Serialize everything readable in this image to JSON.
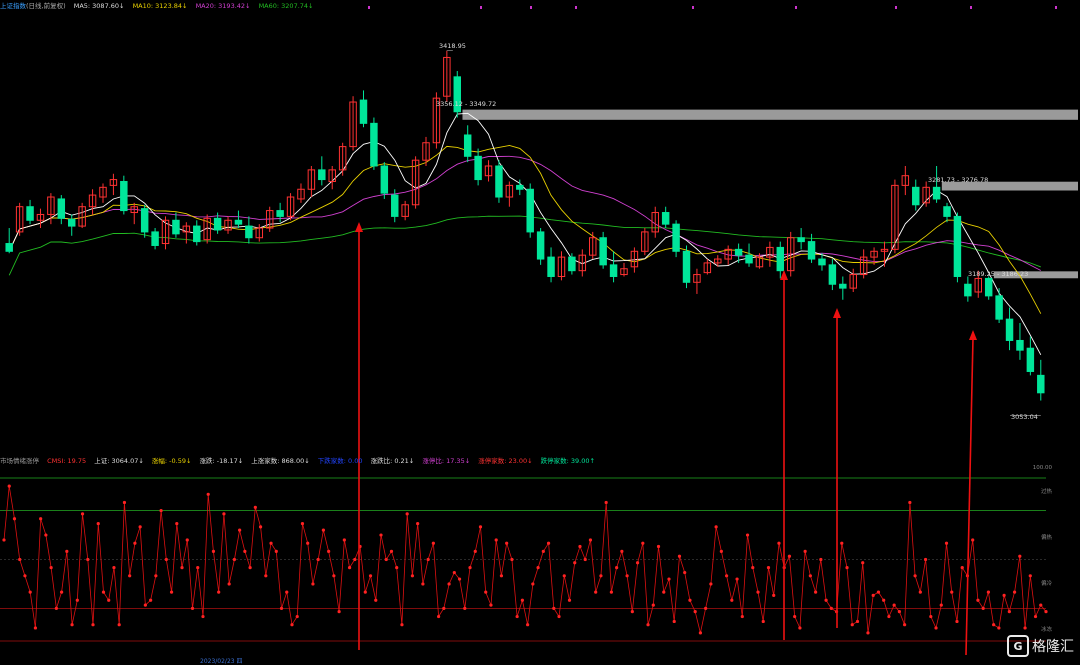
{
  "main_legend": {
    "title": "上证指数",
    "title_suffix": "(日线,前复权)",
    "ma5": "MA5: 3087.60↓",
    "ma10": "MA10: 3123.84↓",
    "ma20": "MA20: 3193.42↓",
    "ma60": "MA60: 3207.74↓"
  },
  "price_labels": {
    "high": "3418.95",
    "zone1": "3356.12 - 3349.72",
    "zone2": "3281.73 - 3276.78",
    "zone3": "3189.25 - 3186.23",
    "low": "3053.04"
  },
  "sub_legend": {
    "title": "市场情绪涨停",
    "cmsi": "CMSI: 19.75",
    "shanghai": "上证: 3064.07↓",
    "change": "涨幅: -0.59↓",
    "change_pts": "涨跌: -18.17↓",
    "up_count": "上涨家数: 868.00↓",
    "blue_item": "下跌家数: 0.00",
    "ratio": "涨跌比: 0.21↓",
    "limit_ratio": "涨停比: 17.35↓",
    "limit_up": "涨停家数: 23.00↓",
    "limit_down": "跌停家数: 39.00↑"
  },
  "sub_axis": {
    "top": "100.00",
    "overheat": "过热",
    "warm": "偏热",
    "cold": "偏冷",
    "freeze": "冰冻"
  },
  "date_label": "2023/02/23 四",
  "watermark": {
    "logo": "G",
    "text": "格隆汇"
  },
  "colors": {
    "up": "#ff3232",
    "down": "#00e69a",
    "ma5": "#ffffff",
    "ma10": "#e8d000",
    "ma20": "#d040d0",
    "ma60": "#22bb22",
    "arrow": "#ee1111"
  },
  "chart_data": [
    {
      "type": "candlestick",
      "title": "上证指数",
      "series_ma": [
        "MA5",
        "MA10",
        "MA20",
        "MA60"
      ],
      "price_range": [
        3040,
        3430
      ],
      "high_marker": 3418.95,
      "low_marker": 3053.04,
      "zones": [
        [
          3349.72,
          3356.12
        ],
        [
          3276.78,
          3281.73
        ],
        [
          3186.23,
          3189.25
        ]
      ],
      "ohlc": [
        [
          3220,
          3236,
          3210,
          3212
        ],
        [
          3232,
          3262,
          3228,
          3258
        ],
        [
          3258,
          3265,
          3240,
          3244
        ],
        [
          3244,
          3256,
          3236,
          3250
        ],
        [
          3250,
          3272,
          3240,
          3268
        ],
        [
          3266,
          3270,
          3240,
          3246
        ],
        [
          3245,
          3250,
          3228,
          3238
        ],
        [
          3238,
          3262,
          3236,
          3258
        ],
        [
          3258,
          3276,
          3250,
          3270
        ],
        [
          3268,
          3282,
          3262,
          3278
        ],
        [
          3280,
          3292,
          3270,
          3286
        ],
        [
          3284,
          3290,
          3250,
          3254
        ],
        [
          3252,
          3262,
          3240,
          3258
        ],
        [
          3256,
          3260,
          3226,
          3232
        ],
        [
          3232,
          3236,
          3214,
          3218
        ],
        [
          3220,
          3248,
          3214,
          3244
        ],
        [
          3244,
          3252,
          3226,
          3230
        ],
        [
          3232,
          3242,
          3220,
          3238
        ],
        [
          3238,
          3244,
          3218,
          3222
        ],
        [
          3224,
          3250,
          3220,
          3246
        ],
        [
          3246,
          3252,
          3230,
          3234
        ],
        [
          3234,
          3248,
          3230,
          3244
        ],
        [
          3244,
          3254,
          3236,
          3240
        ],
        [
          3238,
          3248,
          3220,
          3226
        ],
        [
          3226,
          3240,
          3222,
          3236
        ],
        [
          3236,
          3258,
          3232,
          3254
        ],
        [
          3254,
          3262,
          3242,
          3248
        ],
        [
          3248,
          3272,
          3244,
          3268
        ],
        [
          3266,
          3282,
          3262,
          3276
        ],
        [
          3276,
          3300,
          3268,
          3296
        ],
        [
          3296,
          3310,
          3280,
          3286
        ],
        [
          3284,
          3300,
          3276,
          3296
        ],
        [
          3296,
          3324,
          3290,
          3320
        ],
        [
          3320,
          3372,
          3316,
          3366
        ],
        [
          3368,
          3378,
          3340,
          3344
        ],
        [
          3344,
          3350,
          3296,
          3300
        ],
        [
          3300,
          3304,
          3266,
          3272
        ],
        [
          3270,
          3276,
          3242,
          3248
        ],
        [
          3248,
          3264,
          3244,
          3260
        ],
        [
          3260,
          3310,
          3256,
          3306
        ],
        [
          3306,
          3330,
          3300,
          3324
        ],
        [
          3324,
          3376,
          3318,
          3370
        ],
        [
          3372,
          3419,
          3366,
          3412
        ],
        [
          3392,
          3398,
          3350,
          3356
        ],
        [
          3332,
          3342,
          3304,
          3310
        ],
        [
          3310,
          3318,
          3280,
          3286
        ],
        [
          3290,
          3306,
          3284,
          3300
        ],
        [
          3300,
          3306,
          3262,
          3268
        ],
        [
          3268,
          3284,
          3258,
          3280
        ],
        [
          3280,
          3286,
          3270,
          3276
        ],
        [
          3276,
          3282,
          3226,
          3232
        ],
        [
          3232,
          3236,
          3198,
          3204
        ],
        [
          3206,
          3216,
          3180,
          3186
        ],
        [
          3186,
          3212,
          3182,
          3206
        ],
        [
          3206,
          3210,
          3188,
          3192
        ],
        [
          3192,
          3214,
          3186,
          3208
        ],
        [
          3208,
          3232,
          3204,
          3226
        ],
        [
          3226,
          3232,
          3194,
          3198
        ],
        [
          3198,
          3212,
          3180,
          3186
        ],
        [
          3188,
          3200,
          3186,
          3194
        ],
        [
          3196,
          3216,
          3190,
          3212
        ],
        [
          3212,
          3236,
          3208,
          3232
        ],
        [
          3232,
          3258,
          3226,
          3252
        ],
        [
          3252,
          3258,
          3236,
          3240
        ],
        [
          3240,
          3244,
          3206,
          3212
        ],
        [
          3212,
          3218,
          3174,
          3180
        ],
        [
          3180,
          3194,
          3168,
          3188
        ],
        [
          3190,
          3204,
          3188,
          3200
        ],
        [
          3200,
          3208,
          3196,
          3204
        ],
        [
          3204,
          3218,
          3198,
          3214
        ],
        [
          3214,
          3220,
          3200,
          3208
        ],
        [
          3208,
          3220,
          3196,
          3200
        ],
        [
          3196,
          3210,
          3194,
          3206
        ],
        [
          3206,
          3222,
          3196,
          3216
        ],
        [
          3216,
          3222,
          3184,
          3192
        ],
        [
          3192,
          3232,
          3186,
          3226
        ],
        [
          3226,
          3236,
          3214,
          3222
        ],
        [
          3222,
          3230,
          3200,
          3204
        ],
        [
          3204,
          3210,
          3192,
          3198
        ],
        [
          3198,
          3204,
          3172,
          3178
        ],
        [
          3178,
          3186,
          3162,
          3174
        ],
        [
          3174,
          3194,
          3170,
          3188
        ],
        [
          3188,
          3214,
          3184,
          3206
        ],
        [
          3206,
          3216,
          3198,
          3212
        ],
        [
          3212,
          3222,
          3196,
          3214
        ],
        [
          3214,
          3286,
          3210,
          3280
        ],
        [
          3280,
          3300,
          3270,
          3290
        ],
        [
          3278,
          3286,
          3254,
          3260
        ],
        [
          3262,
          3284,
          3258,
          3278
        ],
        [
          3278,
          3300,
          3262,
          3266
        ],
        [
          3258,
          3262,
          3242,
          3248
        ],
        [
          3248,
          3252,
          3180,
          3186
        ],
        [
          3178,
          3186,
          3160,
          3166
        ],
        [
          3170,
          3192,
          3164,
          3184
        ],
        [
          3184,
          3186,
          3162,
          3166
        ],
        [
          3166,
          3174,
          3138,
          3142
        ],
        [
          3142,
          3154,
          3110,
          3120
        ],
        [
          3120,
          3138,
          3100,
          3110
        ],
        [
          3112,
          3124,
          3084,
          3088
        ],
        [
          3084,
          3100,
          3058,
          3066
        ]
      ]
    },
    {
      "type": "line",
      "title": "市场情绪涨停",
      "ylim": [
        0,
        100
      ],
      "levels": [
        100,
        80,
        20,
        0
      ],
      "values": [
        62,
        95,
        75,
        50,
        40,
        30,
        8,
        75,
        65,
        45,
        20,
        30,
        55,
        10,
        25,
        78,
        50,
        10,
        72,
        30,
        25,
        45,
        10,
        85,
        40,
        60,
        70,
        22,
        25,
        40,
        80,
        50,
        30,
        72,
        45,
        62,
        20,
        45,
        15,
        90,
        55,
        30,
        78,
        35,
        50,
        68,
        55,
        45,
        82,
        70,
        40,
        60,
        55,
        20,
        30,
        10,
        15,
        72,
        60,
        35,
        50,
        68,
        55,
        40,
        18,
        62,
        45,
        50,
        58,
        30,
        40,
        25,
        65,
        50,
        55,
        45,
        10,
        78,
        40,
        72,
        35,
        50,
        60,
        15,
        20,
        35,
        42,
        38,
        20,
        45,
        55,
        70,
        30,
        22,
        62,
        40,
        60,
        50,
        15,
        25,
        10,
        35,
        45,
        55,
        60,
        20,
        15,
        40,
        25,
        48,
        58,
        50,
        62,
        30,
        40,
        85,
        30,
        45,
        55,
        40,
        18,
        48,
        60,
        10,
        22,
        58,
        30,
        38,
        12,
        52,
        42,
        25,
        18,
        5,
        20,
        35,
        70,
        55,
        40,
        25,
        38,
        15,
        65,
        45,
        30,
        12,
        45,
        28,
        60,
        45,
        52,
        15,
        8,
        55,
        40,
        30,
        50,
        25,
        20,
        18,
        60,
        45,
        10,
        12,
        48,
        5,
        28,
        30,
        25,
        15,
        22,
        18,
        10,
        85,
        40,
        30,
        50,
        15,
        8,
        22,
        60,
        30,
        12,
        45,
        40,
        62,
        25,
        20,
        30,
        10,
        8,
        28,
        18,
        30,
        52,
        8,
        40,
        15,
        22,
        18
      ]
    }
  ]
}
